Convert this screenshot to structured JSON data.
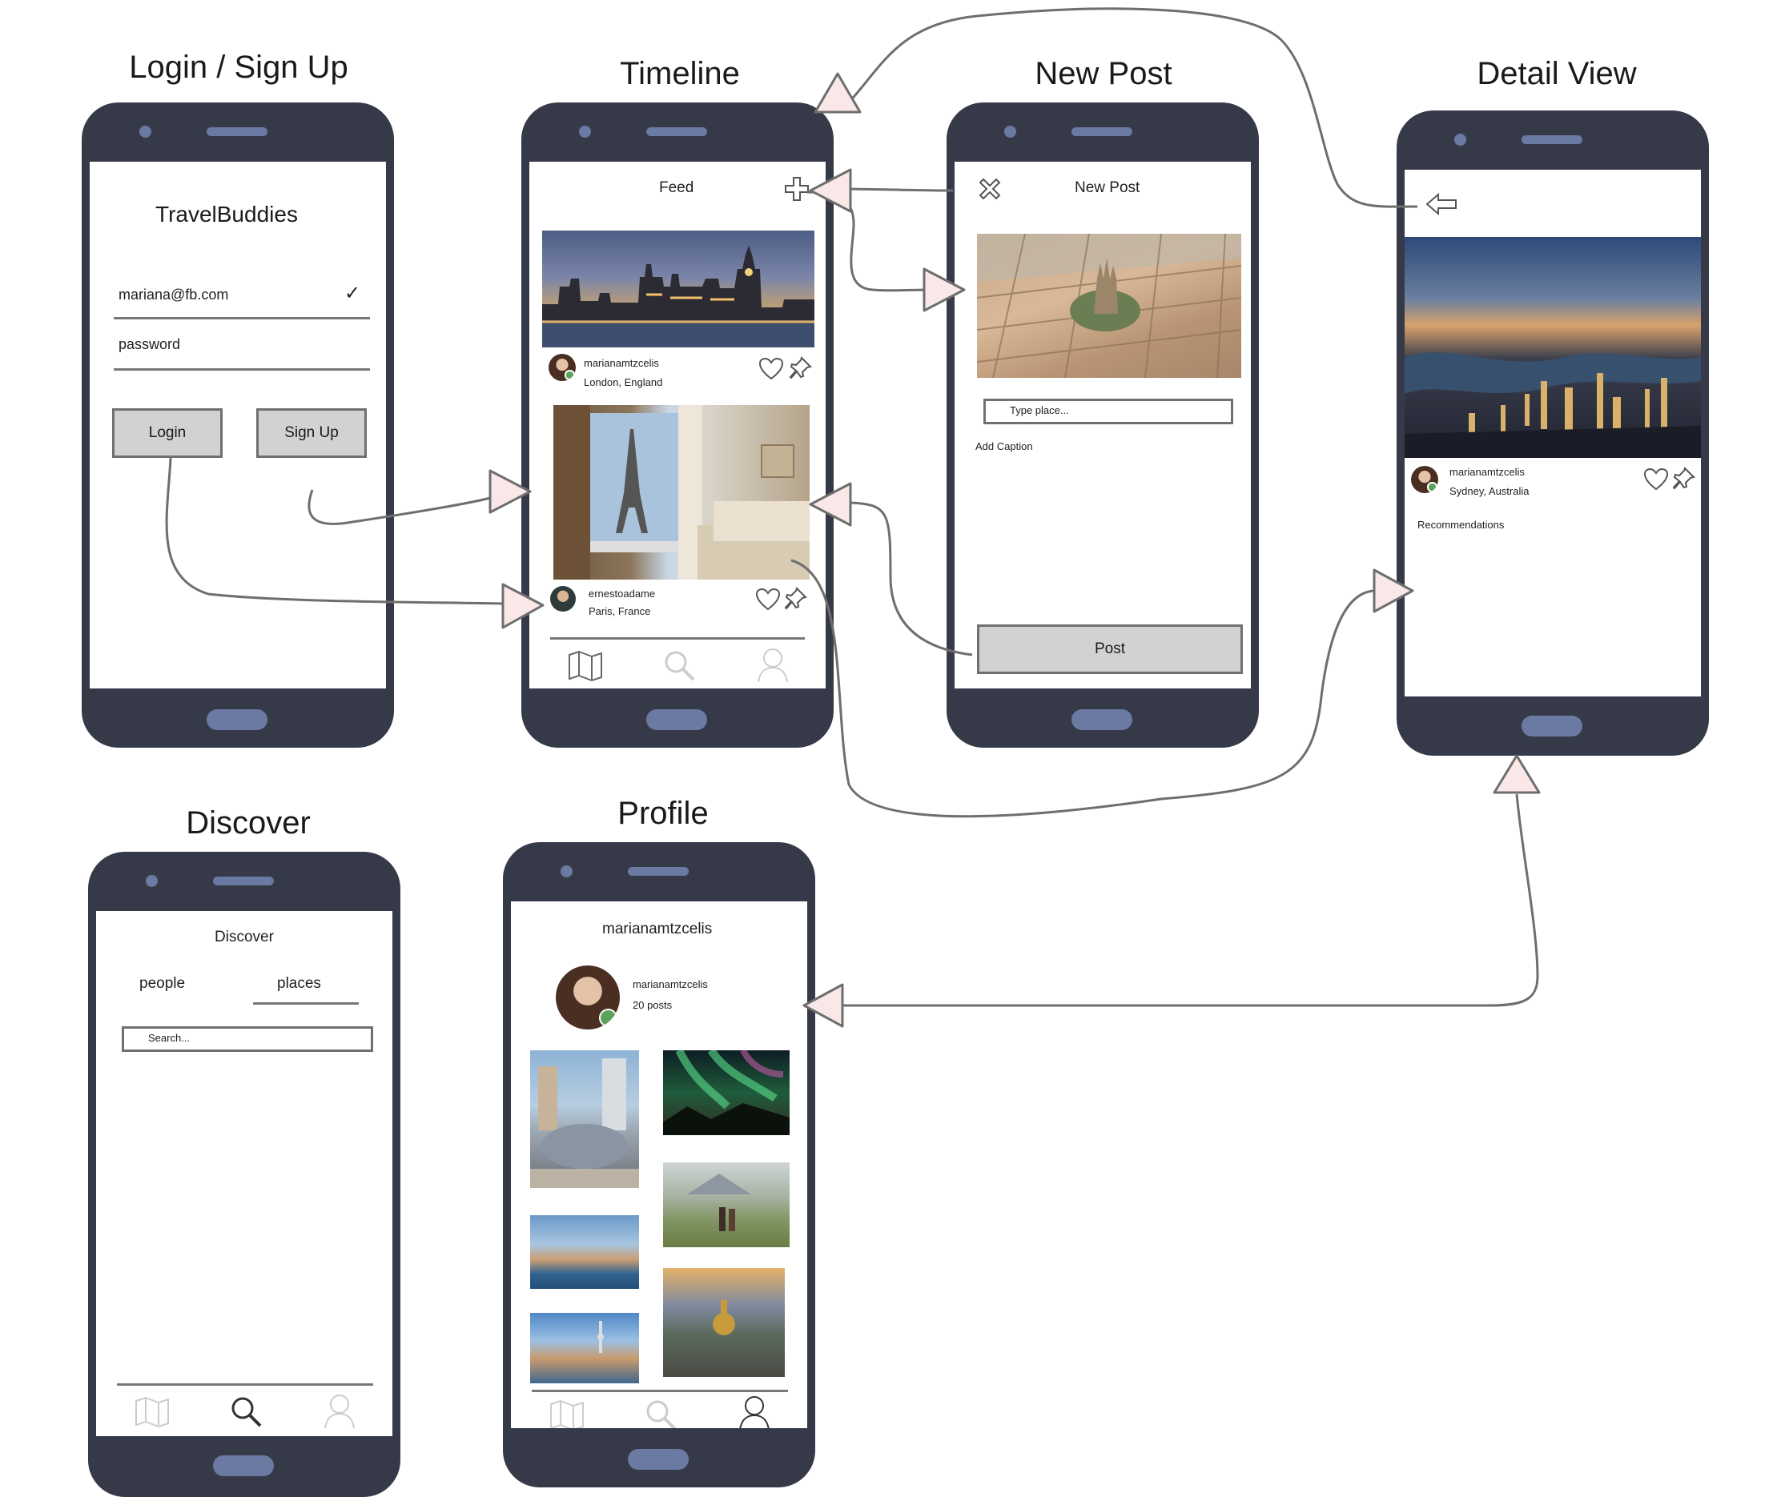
{
  "titles": {
    "login": "Login / Sign Up",
    "timeline": "Timeline",
    "new_post": "New Post",
    "detail": "Detail View",
    "discover": "Discover",
    "profile": "Profile"
  },
  "login": {
    "app_name": "TravelBuddies",
    "email_value": "mariana@fb.com",
    "password_placeholder": "password",
    "login_label": "Login",
    "signup_label": "Sign Up"
  },
  "timeline": {
    "header": "Feed",
    "posts": [
      {
        "user": "marianamtzcelis",
        "location": "London, England"
      },
      {
        "user": "ernestoadame",
        "location": "Paris, France"
      }
    ],
    "nav": [
      "map-icon",
      "search-icon",
      "profile-icon"
    ]
  },
  "new_post": {
    "header": "New Post",
    "place_placeholder": "Type place...",
    "caption_placeholder": "Add Caption",
    "post_label": "Post"
  },
  "detail": {
    "user": "marianamtzcelis",
    "location": "Sydney, Australia",
    "section": "Recommendations"
  },
  "discover": {
    "header": "Discover",
    "tabs": [
      "people",
      "places"
    ],
    "active_tab": "places",
    "search_placeholder": "Search..."
  },
  "profile": {
    "header": "marianamtzcelis",
    "user": "marianamtzcelis",
    "posts_count": "20 posts"
  },
  "colors": {
    "phone_body": "#363a48",
    "phone_accent": "#6b7aa3",
    "arrow_fill": "#fae8e8",
    "connector": "#6e6e6e",
    "online": "#5ba35a"
  }
}
